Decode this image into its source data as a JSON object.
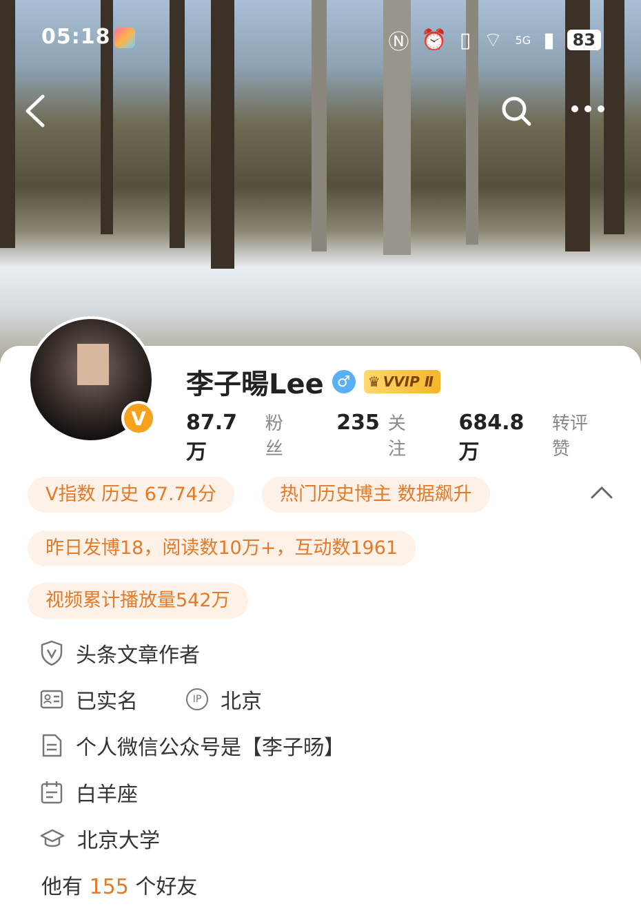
{
  "status_bar": {
    "time": "05:18",
    "battery": "83",
    "network": "5G"
  },
  "profile": {
    "name": "李子暘Lee",
    "gender_symbol": "♂",
    "vip_label": "VVIP Ⅱ",
    "verified_badge": "V",
    "stats": [
      {
        "value": "87.7万",
        "label": "粉丝"
      },
      {
        "value": "235",
        "label": "关注"
      },
      {
        "value": "684.8万",
        "label": "转评赞"
      }
    ]
  },
  "tags": [
    "V指数 历史 67.74分",
    "热门历史博主 数据飙升",
    "昨日发博18，阅读数10万+，互动数1961",
    "视频累计播放量542万"
  ],
  "info": {
    "headline_author": "头条文章作者",
    "real_name": "已实名",
    "ip_label": "IP",
    "ip_location": "北京",
    "wechat": "个人微信公众号是【李子旸】",
    "zodiac": "白羊座",
    "school": "北京大学"
  },
  "friends": {
    "prefix": "他有",
    "count": "155",
    "suffix": "个好友"
  },
  "colors": {
    "accent": "#e37a2a",
    "tag_bg": "#fdf1e8",
    "vip_gold": "#f6b52b",
    "gender_blue": "#5ab0f5"
  }
}
